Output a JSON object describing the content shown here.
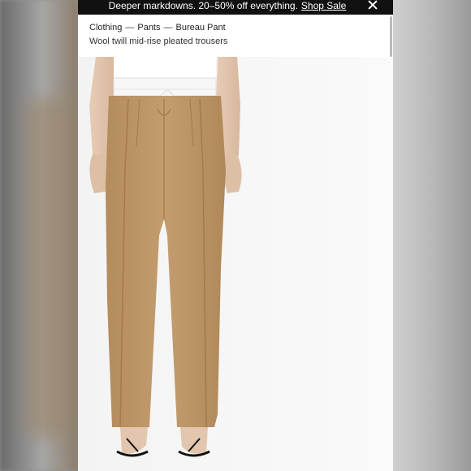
{
  "promo": {
    "text": "Deeper markdowns. 20–50% off everything.",
    "link": "Shop Sale"
  },
  "breadcrumb": {
    "items": [
      "Clothing",
      "Pants",
      "Bureau Pant"
    ],
    "separator": "—"
  },
  "product": {
    "subtitle": "Wool twill mid-rise pleated trousers"
  },
  "icons": {
    "close": "close-icon"
  },
  "colors": {
    "promo_bg": "#111111",
    "trouser": "#c19a6b",
    "background": "#f6f6f6"
  }
}
